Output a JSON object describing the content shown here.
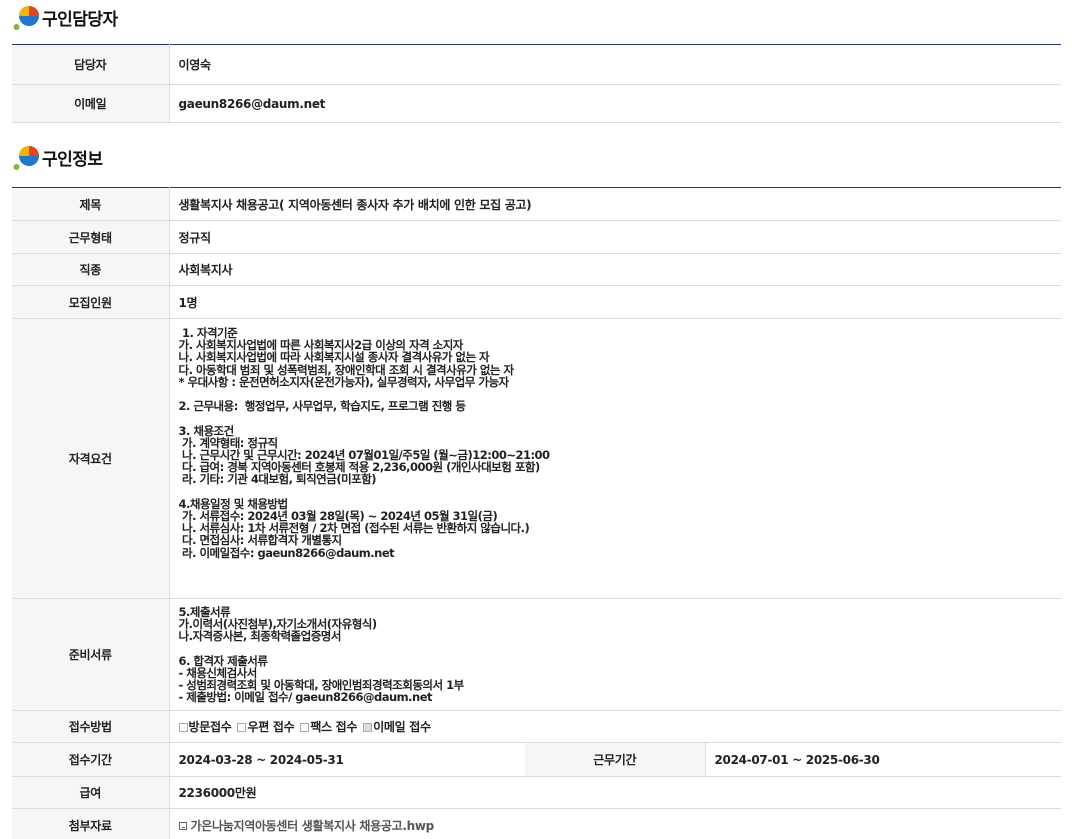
{
  "contact_section": {
    "title": "구인담당자",
    "rows": [
      {
        "label": "담당자",
        "value": "이영숙"
      },
      {
        "label": "이메일",
        "value": "gaeun8266@daum.net"
      }
    ]
  },
  "job_section": {
    "title": "구인정보",
    "title_row": {
      "label": "제목",
      "value": "생활복지사 채용공고( 지역아동센터 종사자 추가 배치에 인한 모집 공고)"
    },
    "work_type": {
      "label": "근무형태",
      "value": "정규직"
    },
    "job_kind": {
      "label": "직종",
      "value": "사회복지사"
    },
    "headcount": {
      "label": "모집인원",
      "value": "1명"
    },
    "qualifications": {
      "label": "자격요건",
      "value": " 1. 자격기준\n가. 사회복지사업법에 따른 사회복지사2급 이상의 자격 소지자\n나. 사회복지사업법에 따라 사회복지시설 종사자 결격사유가 없는 자\n다. 아동학대 범죄 및 성폭력범죄, 장애인학대 조회 시 결격사유가 없는 자\n* 우대사항 : 운전면허소지자(운전가능자), 실무경력자, 사무업무 가능자\n\n2. 근무내용:  행정업무, 사무업무, 학습지도, 프로그램 진행 등\n\n3. 채용조건\n 가. 계약형태: 정규직\n 나. 근무시간 및 근무시간: 2024년 07월01일/주5일 (월~금)12:00~21:00\n 다. 급여: 경북 지역아동센터 호봉제 적용 2,236,000원 (개인사대보험 포함)\n 라. 기타: 기관 4대보험, 퇴직연금(미포함)\n\n4.채용일정 및 채용방법\n 가. 서류접수: 2024년 03월 28일(목) ~ 2024년 05월 31일(금)\n 나. 서류심사: 1차 서류전형 / 2차 면접 (접수된 서류는 반환하지 않습니다.)\n 다. 면접심사: 서류합격자 개별통지\n 라. 이메일접수: gaeun8266@daum.net"
    },
    "documents": {
      "label": "준비서류",
      "value": "5.제출서류\n가.이력서(사진첨부),자기소개서(자유형식)\n나.자격증사본, 최종학력졸업증명서\n\n6. 합격자 제출서류\n- 채용신체검사서\n- 성범죄경력조회 및 아동학대, 장애인범죄경력조회동의서 1부\n- 제출방법: 이메일 접수/ gaeun8266@daum.net"
    },
    "apply_method": {
      "label": "접수방법",
      "options": [
        {
          "label": "방문접수",
          "checked": false
        },
        {
          "label": "우편 접수",
          "checked": false
        },
        {
          "label": "팩스 접수",
          "checked": false
        },
        {
          "label": "이메일 접수",
          "checked": true
        }
      ]
    },
    "period": {
      "label": "접수기간",
      "value": "2024-03-28 ~ 2024-05-31",
      "work_label": "근무기간",
      "work_value": "2024-07-01 ~ 2025-06-30"
    },
    "salary": {
      "label": "급여",
      "value": "2236000만원"
    },
    "attachment": {
      "label": "첨부자료",
      "value": "가은나눔지역아동센터 생활복지사 채용공고.hwp"
    }
  },
  "colors": {
    "accent_line": "#1e3a66",
    "header_bg": "#f6f6f6",
    "border": "#dcdcdc"
  },
  "icons": {
    "section_logo": "colored-circle-logo-icon",
    "file": "file-icon"
  }
}
